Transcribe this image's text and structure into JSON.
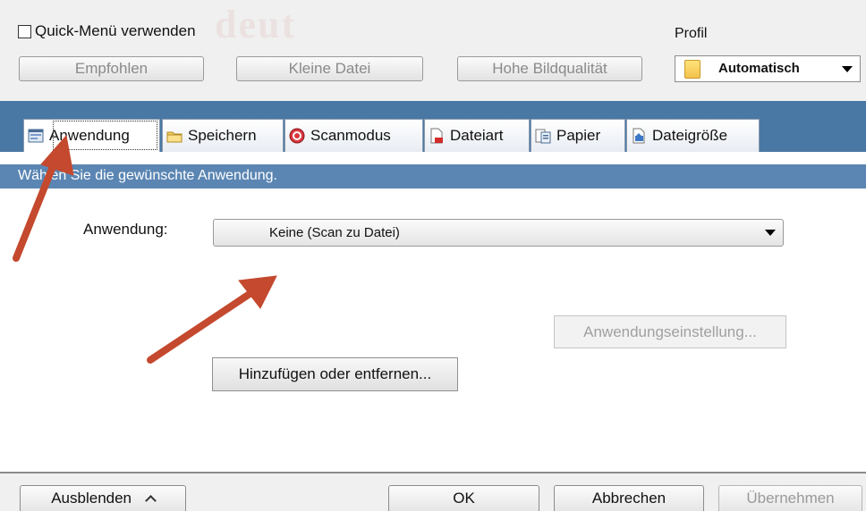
{
  "top": {
    "watermark": "deut",
    "quick_menu_label": "Quick-Menü verwenden",
    "quick_menu_checked": false,
    "profile_label": "Profil",
    "presets": [
      "Empfohlen",
      "Kleine Datei",
      "Hohe Bildqualität"
    ],
    "profile_value": "Automatisch"
  },
  "tabs": [
    {
      "label": "Anwendung",
      "icon": "application-icon",
      "active": true
    },
    {
      "label": "Speichern",
      "icon": "save-folder-icon",
      "active": false
    },
    {
      "label": "Scanmodus",
      "icon": "scan-mode-icon",
      "active": false
    },
    {
      "label": "Dateiart",
      "icon": "file-type-icon",
      "active": false
    },
    {
      "label": "Papier",
      "icon": "paper-icon",
      "active": false
    },
    {
      "label": "Dateigröße",
      "icon": "file-size-icon",
      "active": false
    }
  ],
  "content": {
    "instruction": "Wählen Sie die gewünschte Anwendung.",
    "app_label": "Anwendung:",
    "app_value": "Keine (Scan zu Datei)",
    "app_settings_button": "Anwendungseinstellung...",
    "add_remove_button": "Hinzufügen oder entfernen..."
  },
  "bottom": {
    "hide_button": "Ausblenden",
    "ok_button": "OK",
    "cancel_button": "Abbrechen",
    "apply_button": "Übernehmen"
  },
  "colors": {
    "tab_bar": "#4a78a4",
    "instruction_bar": "#5b86b3",
    "annotation_arrow": "#c4492e"
  }
}
